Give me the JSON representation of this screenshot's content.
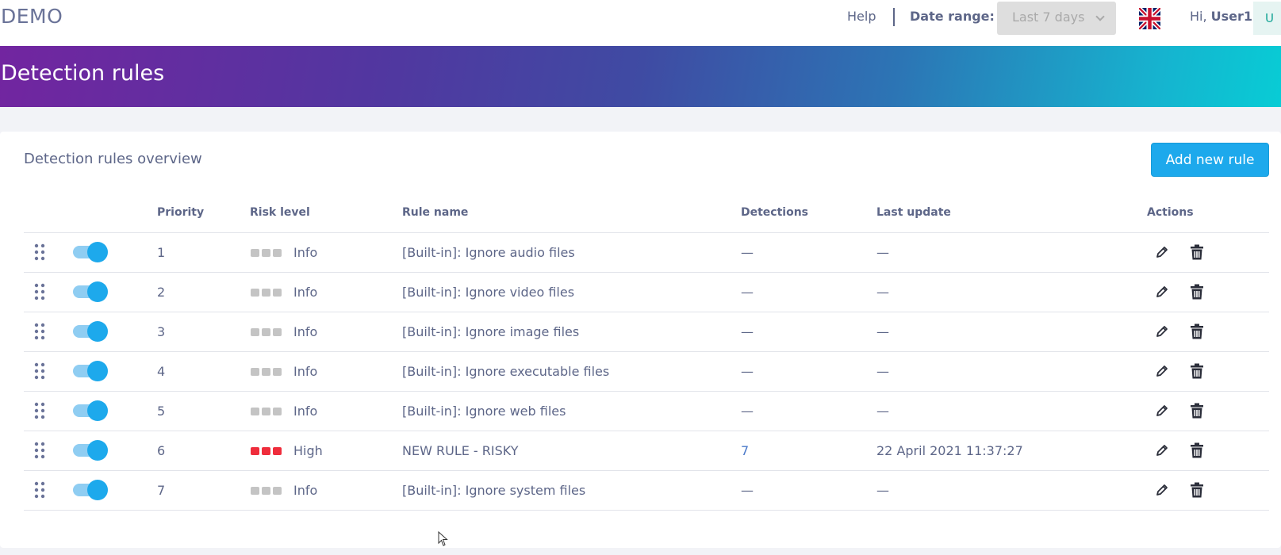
{
  "header": {
    "logo": "DEMO",
    "help_label": "Help",
    "date_range_label": "Date range:",
    "date_range_value": "Last 7 days",
    "greeting_prefix": "Hi,",
    "user_name": "User1",
    "avatar_initial": "U",
    "language_icon": "uk-flag-icon"
  },
  "banner": {
    "title": "Detection rules"
  },
  "card": {
    "title": "Detection rules overview",
    "add_button_label": "Add new rule"
  },
  "table": {
    "headers": {
      "priority": "Priority",
      "risk_level": "Risk level",
      "rule_name": "Rule name",
      "detections": "Detections",
      "last_update": "Last update",
      "actions": "Actions"
    },
    "rows": [
      {
        "priority": "1",
        "enabled": true,
        "risk_level": "Info",
        "risk_color": "#c4c4c4",
        "rule_name": "[Built-in]: Ignore audio files",
        "detections": "—",
        "last_update": "—"
      },
      {
        "priority": "2",
        "enabled": true,
        "risk_level": "Info",
        "risk_color": "#c4c4c4",
        "rule_name": "[Built-in]: Ignore video files",
        "detections": "—",
        "last_update": "—"
      },
      {
        "priority": "3",
        "enabled": true,
        "risk_level": "Info",
        "risk_color": "#c4c4c4",
        "rule_name": "[Built-in]: Ignore image files",
        "detections": "—",
        "last_update": "—"
      },
      {
        "priority": "4",
        "enabled": true,
        "risk_level": "Info",
        "risk_color": "#c4c4c4",
        "rule_name": "[Built-in]: Ignore executable files",
        "detections": "—",
        "last_update": "—"
      },
      {
        "priority": "5",
        "enabled": true,
        "risk_level": "Info",
        "risk_color": "#c4c4c4",
        "rule_name": "[Built-in]: Ignore web files",
        "detections": "—",
        "last_update": "—"
      },
      {
        "priority": "6",
        "enabled": true,
        "risk_level": "High",
        "risk_color": "#ef2d3c",
        "rule_name": "NEW RULE - RISKY",
        "detections": "7",
        "last_update": "22 April 2021 11:37:27"
      },
      {
        "priority": "7",
        "enabled": true,
        "risk_level": "Info",
        "risk_color": "#c4c4c4",
        "rule_name": "[Built-in]: Ignore system files",
        "detections": "—",
        "last_update": "—"
      }
    ]
  },
  "colors": {
    "accent": "#1da9ec",
    "text": "#5d6688",
    "high_risk": "#ef2d3c",
    "info_risk": "#c4c4c4",
    "link": "#4a78c9"
  }
}
